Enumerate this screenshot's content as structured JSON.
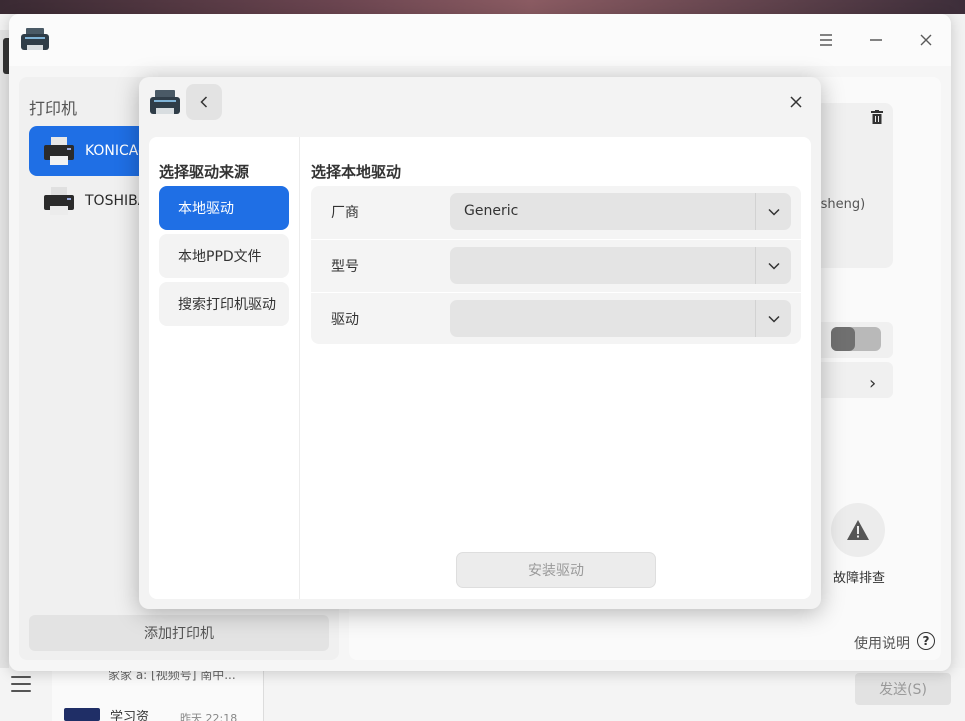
{
  "background": {
    "chat": {
      "row1_text": "家家 a: [视频号] 南中...",
      "row2_title": "学习资",
      "row2_time": "昨天 22:18"
    },
    "send_label": "发送(S)"
  },
  "main_window": {
    "section_title": "打印机",
    "printers": [
      {
        "label": "KONICA-"
      },
      {
        "label": "TOSHIBA"
      }
    ],
    "add_printer_label": "添加打印机",
    "detail_partial_text": "isheng)",
    "troubleshoot_label": "故障排查",
    "help_label": "使用说明",
    "help_icon_glyph": "?"
  },
  "dialog": {
    "sidebar_title": "选择驱动来源",
    "sidebar_items": [
      {
        "label": "本地驱动",
        "active": true
      },
      {
        "label": "本地PPD文件",
        "active": false
      },
      {
        "label": "搜索打印机驱动",
        "active": false
      }
    ],
    "main_title": "选择本地驱动",
    "fields": {
      "vendor": {
        "label": "厂商",
        "value": "Generic"
      },
      "model": {
        "label": "型号",
        "value": ""
      },
      "driver": {
        "label": "驱动",
        "value": ""
      }
    },
    "install_label": "安装驱动"
  },
  "colors": {
    "accent": "#1f6fe5",
    "disabled_text": "#9a9a9a"
  },
  "icons": [
    "printer-icon",
    "back-arrow-icon",
    "close-icon",
    "chevron-down-icon",
    "menu-icon",
    "minimize-icon",
    "trash-icon",
    "warning-icon",
    "help-icon"
  ]
}
